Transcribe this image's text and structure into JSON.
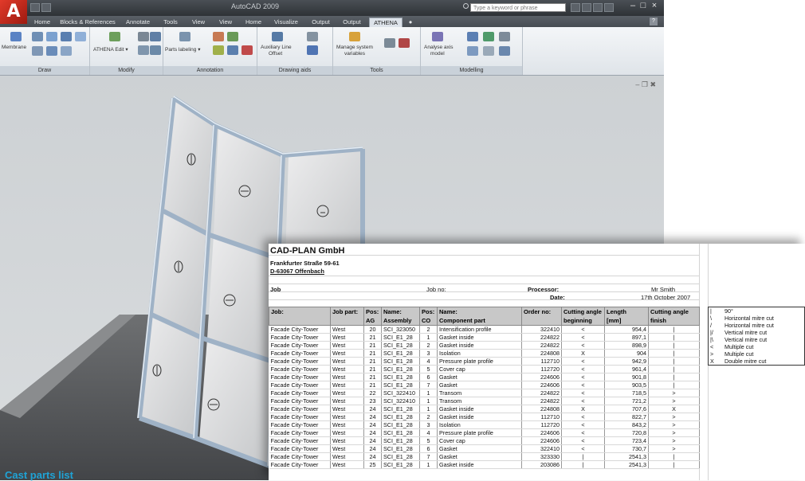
{
  "app": {
    "logo": "A",
    "title": "AutoCAD 2009",
    "search_placeholder": "Type a keyword or phrase",
    "help": "?"
  },
  "tabs": [
    "Home",
    "Blocks & References",
    "Annotate",
    "Tools",
    "View",
    "View",
    "Home",
    "Visualize",
    "Output",
    "Output",
    "ATHENA",
    "●"
  ],
  "ribbon": {
    "draw": {
      "title": "Draw",
      "membrane": "Membrane"
    },
    "modify": {
      "title": "Modify",
      "athena_edit": "ATHENA Edit ▾"
    },
    "annotation": {
      "title": "Annotation",
      "parts_labeling": "Parts labeling ▾"
    },
    "drawing_aids": {
      "title": "Drawing aids",
      "aux_line_1": "Auxiliary Line",
      "aux_line_2": "Offset"
    },
    "tools": {
      "title": "Tools",
      "manage_1": "Manage system",
      "manage_2": "variables"
    },
    "modelling": {
      "title": "Modelling",
      "analyse_1": "Analyse axis",
      "analyse_2": "model"
    }
  },
  "viewport": {
    "controls": "– ❐ ✖"
  },
  "caption": "Cast parts list",
  "sheet": {
    "company": "CAD-PLAN GmbH",
    "street": "Frankfurter Straße 59-61",
    "city": "D-63067 Offenbach",
    "job_label": "Job",
    "job_no_label": "Job no:",
    "processor_label": "Processor:",
    "processor_value": "Mr Smith",
    "date_label": "Date:",
    "date_value": "17th October 2007",
    "headers": [
      [
        "Job:",
        ""
      ],
      [
        "Job part:",
        ""
      ],
      [
        "Pos:",
        "AG"
      ],
      [
        "Name:",
        "Assembly"
      ],
      [
        "Pos:",
        "CO"
      ],
      [
        "Name:",
        "Component part"
      ],
      [
        "Order no:",
        ""
      ],
      [
        "Cutting angle",
        "beginning"
      ],
      [
        "Length",
        "[mm]"
      ],
      [
        "Cutting angle",
        "finish"
      ]
    ],
    "rows": [
      [
        "Facade City-Tower",
        "West",
        "20",
        "SCI_323050",
        "2",
        "Intensification profile",
        "322410",
        "<",
        "954,4",
        "|"
      ],
      [
        "Facade City-Tower",
        "West",
        "21",
        "SCI_E1_28",
        "1",
        "Gasket inside",
        "224822",
        "<",
        "897,1",
        "|"
      ],
      [
        "Facade City-Tower",
        "West",
        "21",
        "SCI_E1_28",
        "2",
        "Gasket inside",
        "224822",
        "<",
        "898,9",
        "|"
      ],
      [
        "Facade City-Tower",
        "West",
        "21",
        "SCI_E1_28",
        "3",
        "Isolation",
        "224808",
        "X",
        "904",
        "|"
      ],
      [
        "Facade City-Tower",
        "West",
        "21",
        "SCI_E1_28",
        "4",
        "Pressure plate profile",
        "112710",
        "<",
        "942,9",
        "|"
      ],
      [
        "Facade City-Tower",
        "West",
        "21",
        "SCI_E1_28",
        "5",
        "Cover cap",
        "112720",
        "<",
        "961,4",
        "|"
      ],
      [
        "Facade City-Tower",
        "West",
        "21",
        "SCI_E1_28",
        "6",
        "Gasket",
        "224606",
        "<",
        "901,8",
        "|"
      ],
      [
        "Facade City-Tower",
        "West",
        "21",
        "SCI_E1_28",
        "7",
        "Gasket",
        "224606",
        "<",
        "903,5",
        "|"
      ],
      [
        "Facade City-Tower",
        "West",
        "22",
        "SCI_322410",
        "1",
        "Transom",
        "224822",
        "<",
        "718,5",
        ">"
      ],
      [
        "Facade City-Tower",
        "West",
        "23",
        "SCI_322410",
        "1",
        "Transom",
        "224822",
        "<",
        "721,2",
        ">"
      ],
      [
        "Facade City-Tower",
        "West",
        "24",
        "SCI_E1_28",
        "1",
        "Gasket inside",
        "224808",
        "X",
        "707,6",
        "X"
      ],
      [
        "Facade City-Tower",
        "West",
        "24",
        "SCI_E1_28",
        "2",
        "Gasket inside",
        "112710",
        "<",
        "822,7",
        ">"
      ],
      [
        "Facade City-Tower",
        "West",
        "24",
        "SCI_E1_28",
        "3",
        "Isolation",
        "112720",
        "<",
        "843,2",
        ">"
      ],
      [
        "Facade City-Tower",
        "West",
        "24",
        "SCI_E1_28",
        "4",
        "Pressure plate profile",
        "224606",
        "<",
        "720,8",
        ">"
      ],
      [
        "Facade City-Tower",
        "West",
        "24",
        "SCI_E1_28",
        "5",
        "Cover cap",
        "224606",
        "<",
        "723,4",
        ">"
      ],
      [
        "Facade City-Tower",
        "West",
        "24",
        "SCI_E1_28",
        "6",
        "Gasket",
        "322410",
        "<",
        "730,7",
        ">"
      ],
      [
        "Facade City-Tower",
        "West",
        "24",
        "SCI_E1_28",
        "7",
        "Gasket",
        "323330",
        "|",
        "2541,3",
        "|"
      ],
      [
        "Facade City-Tower",
        "West",
        "25",
        "SCI_E1_28",
        "1",
        "Gasket inside",
        "203086",
        "|",
        "2541,3",
        "|"
      ]
    ],
    "legend": [
      [
        "|",
        "90°"
      ],
      [
        "\\",
        "Horizontal mitre cut"
      ],
      [
        "/",
        "Horizontal mitre cut"
      ],
      [
        "|/",
        "Vertical mitre cut"
      ],
      [
        "|\\",
        "Vertical mitre cut"
      ],
      [
        "<",
        "Multiple cut"
      ],
      [
        ">",
        "Multiple cut"
      ],
      [
        "X",
        "Double mitre cut"
      ]
    ]
  }
}
